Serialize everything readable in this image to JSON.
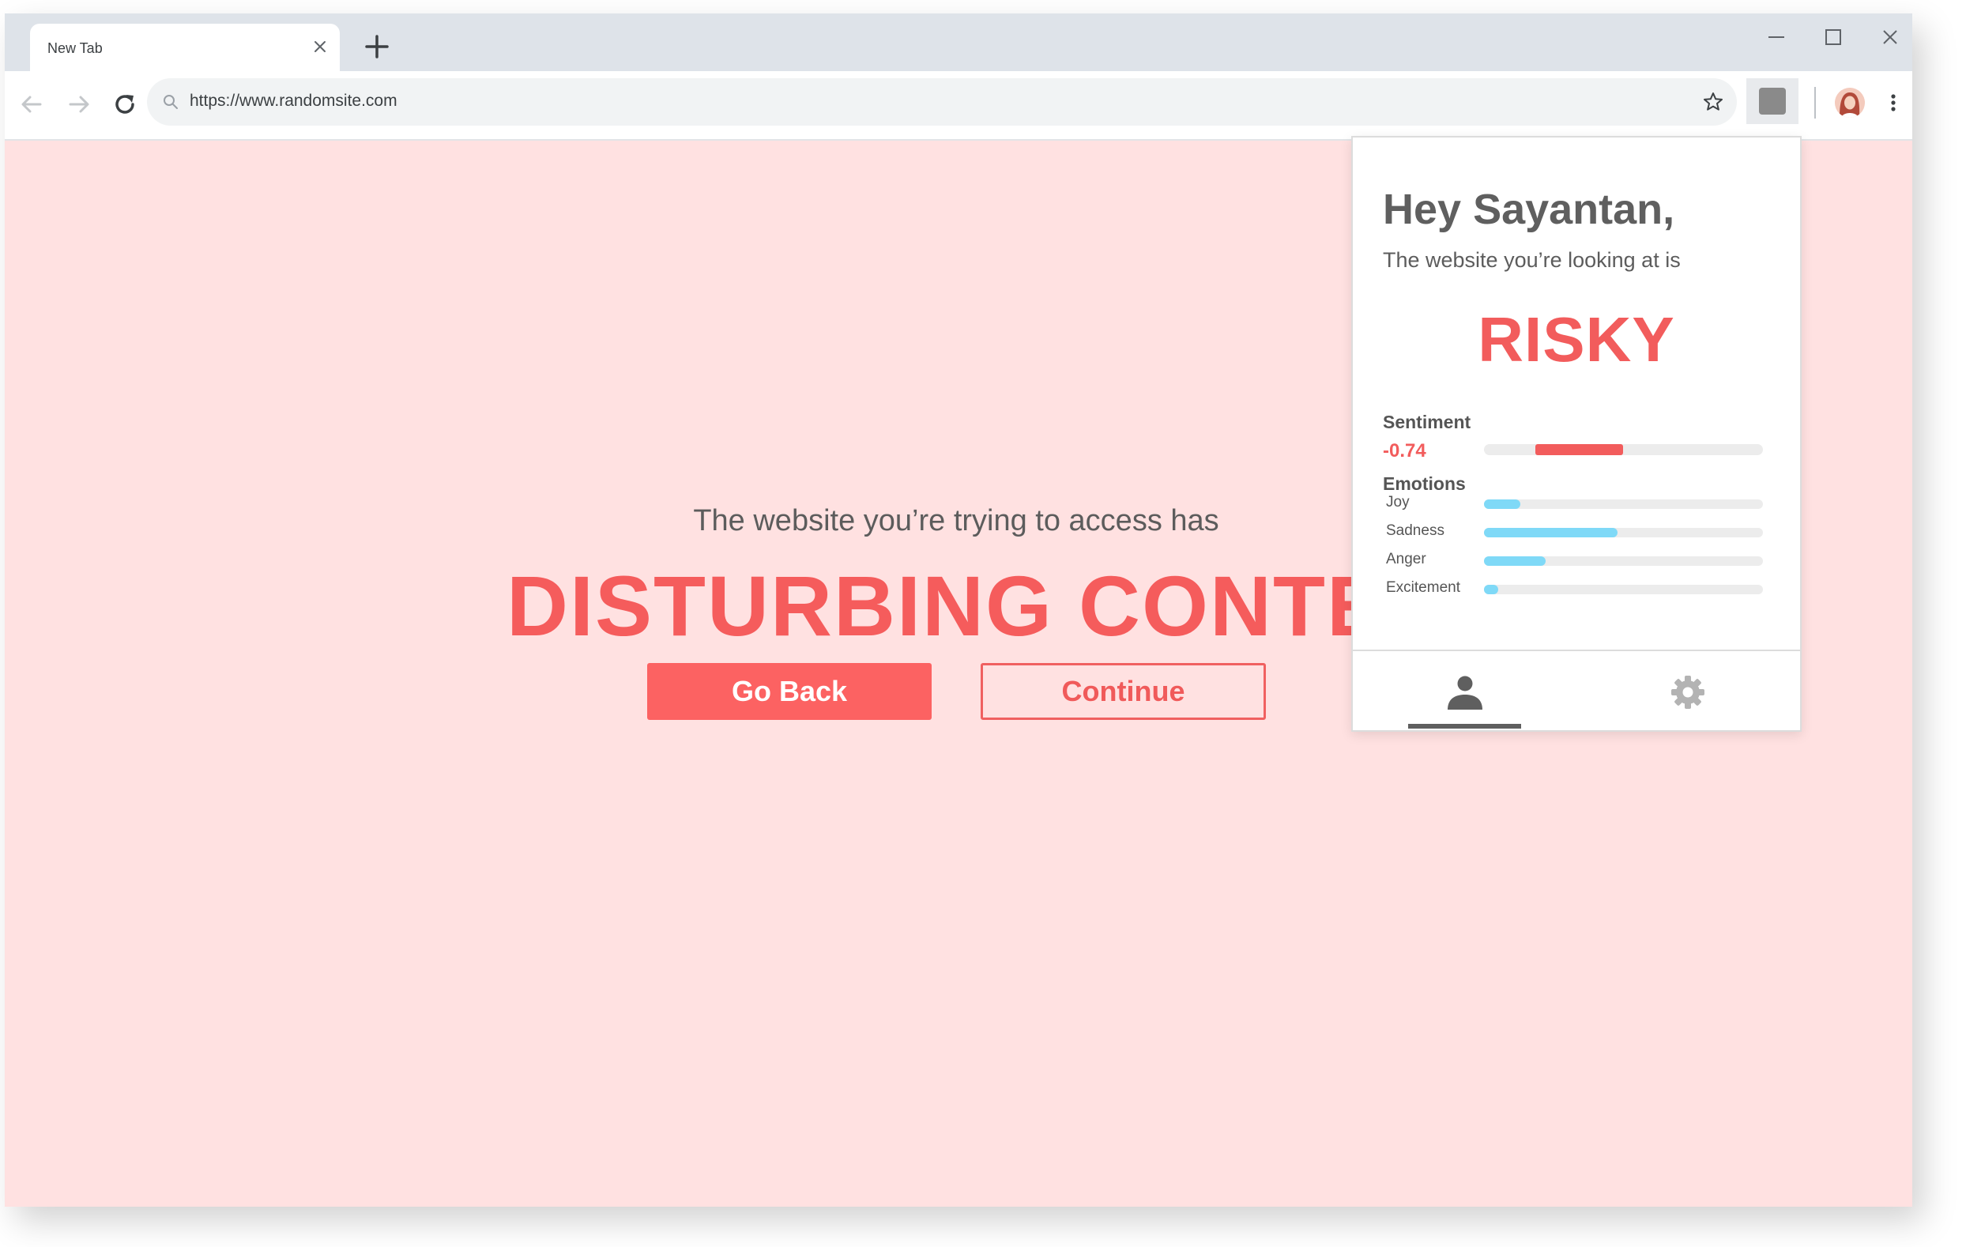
{
  "browser": {
    "tab_title": "New Tab",
    "url": "https://www.randomsite.com"
  },
  "page": {
    "subtitle": "The website you’re trying to access has",
    "headline": "DISTURBING CONTENT",
    "go_back_label": "Go Back",
    "continue_label": "Continue",
    "background_color": "#ffe1e1",
    "accent_color": "#f25c5c"
  },
  "popup": {
    "greeting": "Hey Sayantan,",
    "description": "The website you’re looking at is",
    "risk_level": "RISKY",
    "sentiment_label": "Sentiment",
    "sentiment_value": "-0.74",
    "sentiment_bar": {
      "start": 0.185,
      "end": 0.5
    },
    "emotions_label": "Emotions",
    "emotions": [
      {
        "name": "Joy",
        "level": 0.13
      },
      {
        "name": "Sadness",
        "level": 0.48
      },
      {
        "name": "Anger",
        "level": 0.22
      },
      {
        "name": "Excitement",
        "level": 0.05
      }
    ],
    "footer_tabs": [
      {
        "icon": "person-icon",
        "active": true
      },
      {
        "icon": "gear-icon",
        "active": false
      }
    ]
  }
}
